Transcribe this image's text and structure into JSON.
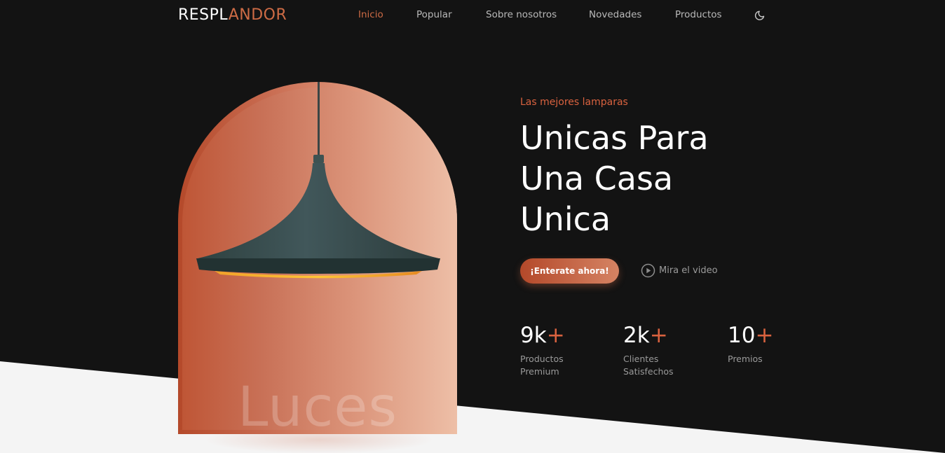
{
  "brand": {
    "logo_part1": "RESPL",
    "logo_part2": "ANDOR"
  },
  "nav": {
    "items": [
      {
        "label": "Inicio",
        "active": true
      },
      {
        "label": "Popular",
        "active": false
      },
      {
        "label": "Sobre nosotros",
        "active": false
      },
      {
        "label": "Novedades",
        "active": false
      },
      {
        "label": "Productos",
        "active": false
      }
    ],
    "theme_icon": "moon-icon"
  },
  "hero": {
    "image_word": "Luces",
    "subtitle": "Las mejores lamparas",
    "title_lines": [
      "Unicas Para",
      "Una Casa",
      "Unica"
    ],
    "cta_label": "¡Enterate ahora!",
    "video_label": "Mira el video",
    "video_icon": "play-circle-icon"
  },
  "stats": [
    {
      "value": "9k",
      "plus": "+",
      "label_lines": [
        "Productos",
        "Premium"
      ]
    },
    {
      "value": "2k",
      "plus": "+",
      "label_lines": [
        "Clientes",
        "Satisfechos"
      ]
    },
    {
      "value": "10",
      "plus": "+",
      "label_lines": [
        "Premios"
      ]
    }
  ],
  "colors": {
    "background": "#131313",
    "accent": "#d9623f",
    "floor": "#f4f4f4",
    "text": "#ffffff",
    "muted": "#9a9a9a"
  }
}
